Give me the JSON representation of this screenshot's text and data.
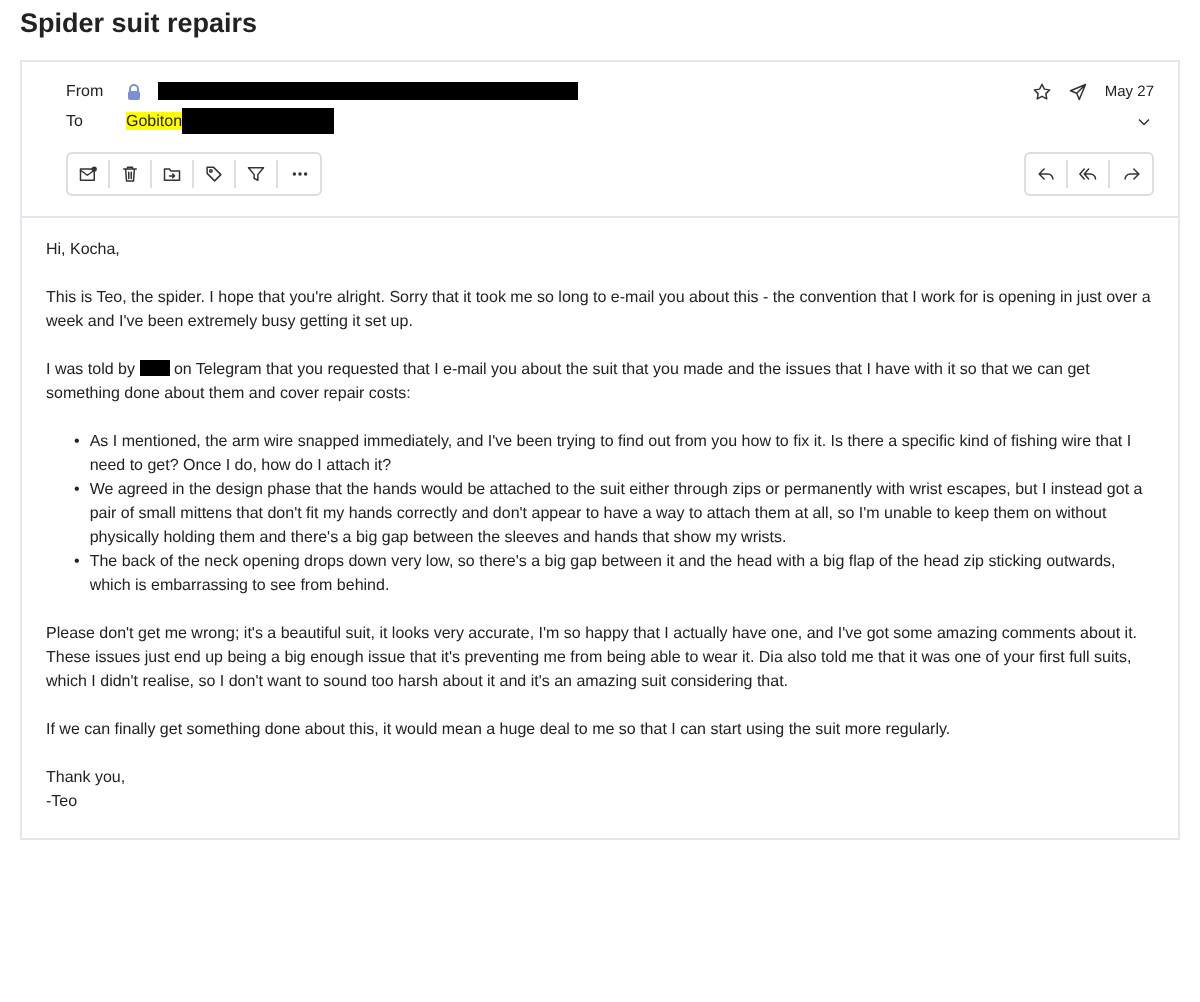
{
  "subject": "Spider suit repairs",
  "header": {
    "from_label": "From",
    "from_redacted": true,
    "to_label": "To",
    "to_name": "Gobiton",
    "to_highlighted": true,
    "to_redacted": true,
    "date": "May 27",
    "expanded": false
  },
  "toolbar_left": [
    {
      "kind": "mark-read"
    },
    {
      "kind": "delete"
    },
    {
      "kind": "move"
    },
    {
      "kind": "tag"
    },
    {
      "kind": "filter"
    },
    {
      "kind": "more"
    }
  ],
  "toolbar_right": [
    {
      "kind": "reply"
    },
    {
      "kind": "reply-all"
    },
    {
      "kind": "forward"
    }
  ],
  "body": [
    {
      "kind": "text",
      "text": "Hi, Kocha,"
    },
    {
      "kind": "text",
      "text": "This is Teo, the spider. I hope that you're alright. Sorry that it took me so long to e-mail you about this - the convention that I work for is opening in just over a week and I've been extremely busy getting it set up."
    },
    {
      "kind": "redacted",
      "before": "I was told by",
      "after": "on Telegram that you requested that I e-mail you about the suit that you made and the issues that I have with it so that we can get something done about them and cover repair costs:"
    },
    {
      "kind": "list",
      "bullet": "•",
      "items": [
        "As I mentioned, the arm wire snapped immediately, and I've been trying to find out from you how to fix it. Is there a specific kind of fishing wire that I need to get? Once I do, how do I attach it?",
        "We agreed in the design phase that the hands would be attached to the suit either through zips or permanently with wrist escapes, but I instead got a pair of small mittens that don't fit my hands correctly and don't appear to have a way to attach them at all, so I'm unable to keep them on without physically holding them and there's a big gap between the sleeves and hands that show my wrists.",
        "The back of the neck opening drops down very low, so there's a big gap between it and the head with a big flap of the head zip sticking outwards, which is embarrassing to see from behind."
      ]
    },
    {
      "kind": "text",
      "text": "Please don't get me wrong; it's a beautiful suit, it looks very accurate, I'm so happy that I actually have one, and I've got some amazing comments about it. These issues just end up being a big enough issue that it's preventing me from being able to wear it. Dia also told me that it was one of your first full suits, which I didn't realise, so I don't want to sound too harsh about it and it's an amazing suit considering that."
    },
    {
      "kind": "text",
      "text": "If we can finally get something done about this, it would mean a huge deal to me so that I can start using the suit more regularly."
    },
    {
      "kind": "lines",
      "lines": [
        "Thank you,",
        "-Teo"
      ]
    }
  ]
}
